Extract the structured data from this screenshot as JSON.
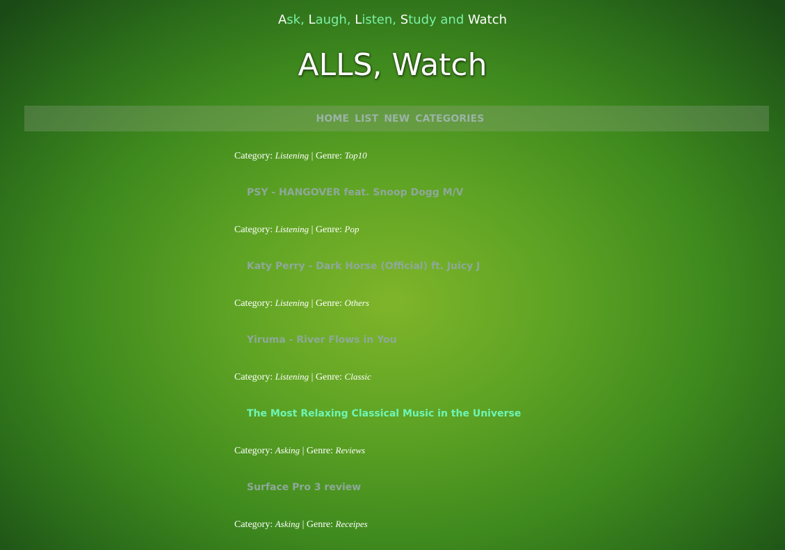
{
  "header": {
    "tagline_parts": [
      {
        "text": "A",
        "style": "w"
      },
      {
        "text": "sk, ",
        "style": "g"
      },
      {
        "text": "L",
        "style": "w"
      },
      {
        "text": "augh, ",
        "style": "g"
      },
      {
        "text": "L",
        "style": "w"
      },
      {
        "text": "isten, ",
        "style": "g"
      },
      {
        "text": "S",
        "style": "w"
      },
      {
        "text": "tudy and ",
        "style": "g"
      },
      {
        "text": "Watch",
        "style": "w"
      }
    ],
    "title": "ALLS, Watch"
  },
  "nav": {
    "items": [
      "HOME",
      "LIST",
      "NEW",
      "CATEGORIES"
    ]
  },
  "labels": {
    "category": "Category:",
    "separator": "|",
    "genre": "Genre:"
  },
  "entries": [
    {
      "category": "Listening",
      "genre": "Top10",
      "title": "PSY - HANGOVER feat. Snoop Dogg M/V",
      "active": false
    },
    {
      "category": "Listening",
      "genre": "Pop",
      "title": "Katy Perry - Dark Horse (Official) ft. Juicy J",
      "active": false
    },
    {
      "category": "Listening",
      "genre": "Others",
      "title": "Yiruma - River Flows in You",
      "active": false
    },
    {
      "category": "Listening",
      "genre": "Classic",
      "title": "The Most Relaxing Classical Music in the Universe",
      "active": true
    },
    {
      "category": "Asking",
      "genre": "Reviews",
      "title": "Surface Pro 3 review",
      "active": false
    },
    {
      "category": "Asking",
      "genre": "Receipes",
      "title": "",
      "active": false
    }
  ],
  "colors": {
    "tagline_green": "#7cf0a6",
    "link": "#8ea89a",
    "link_active": "#6ff5b4",
    "nav_text": "#9bb3a7"
  }
}
